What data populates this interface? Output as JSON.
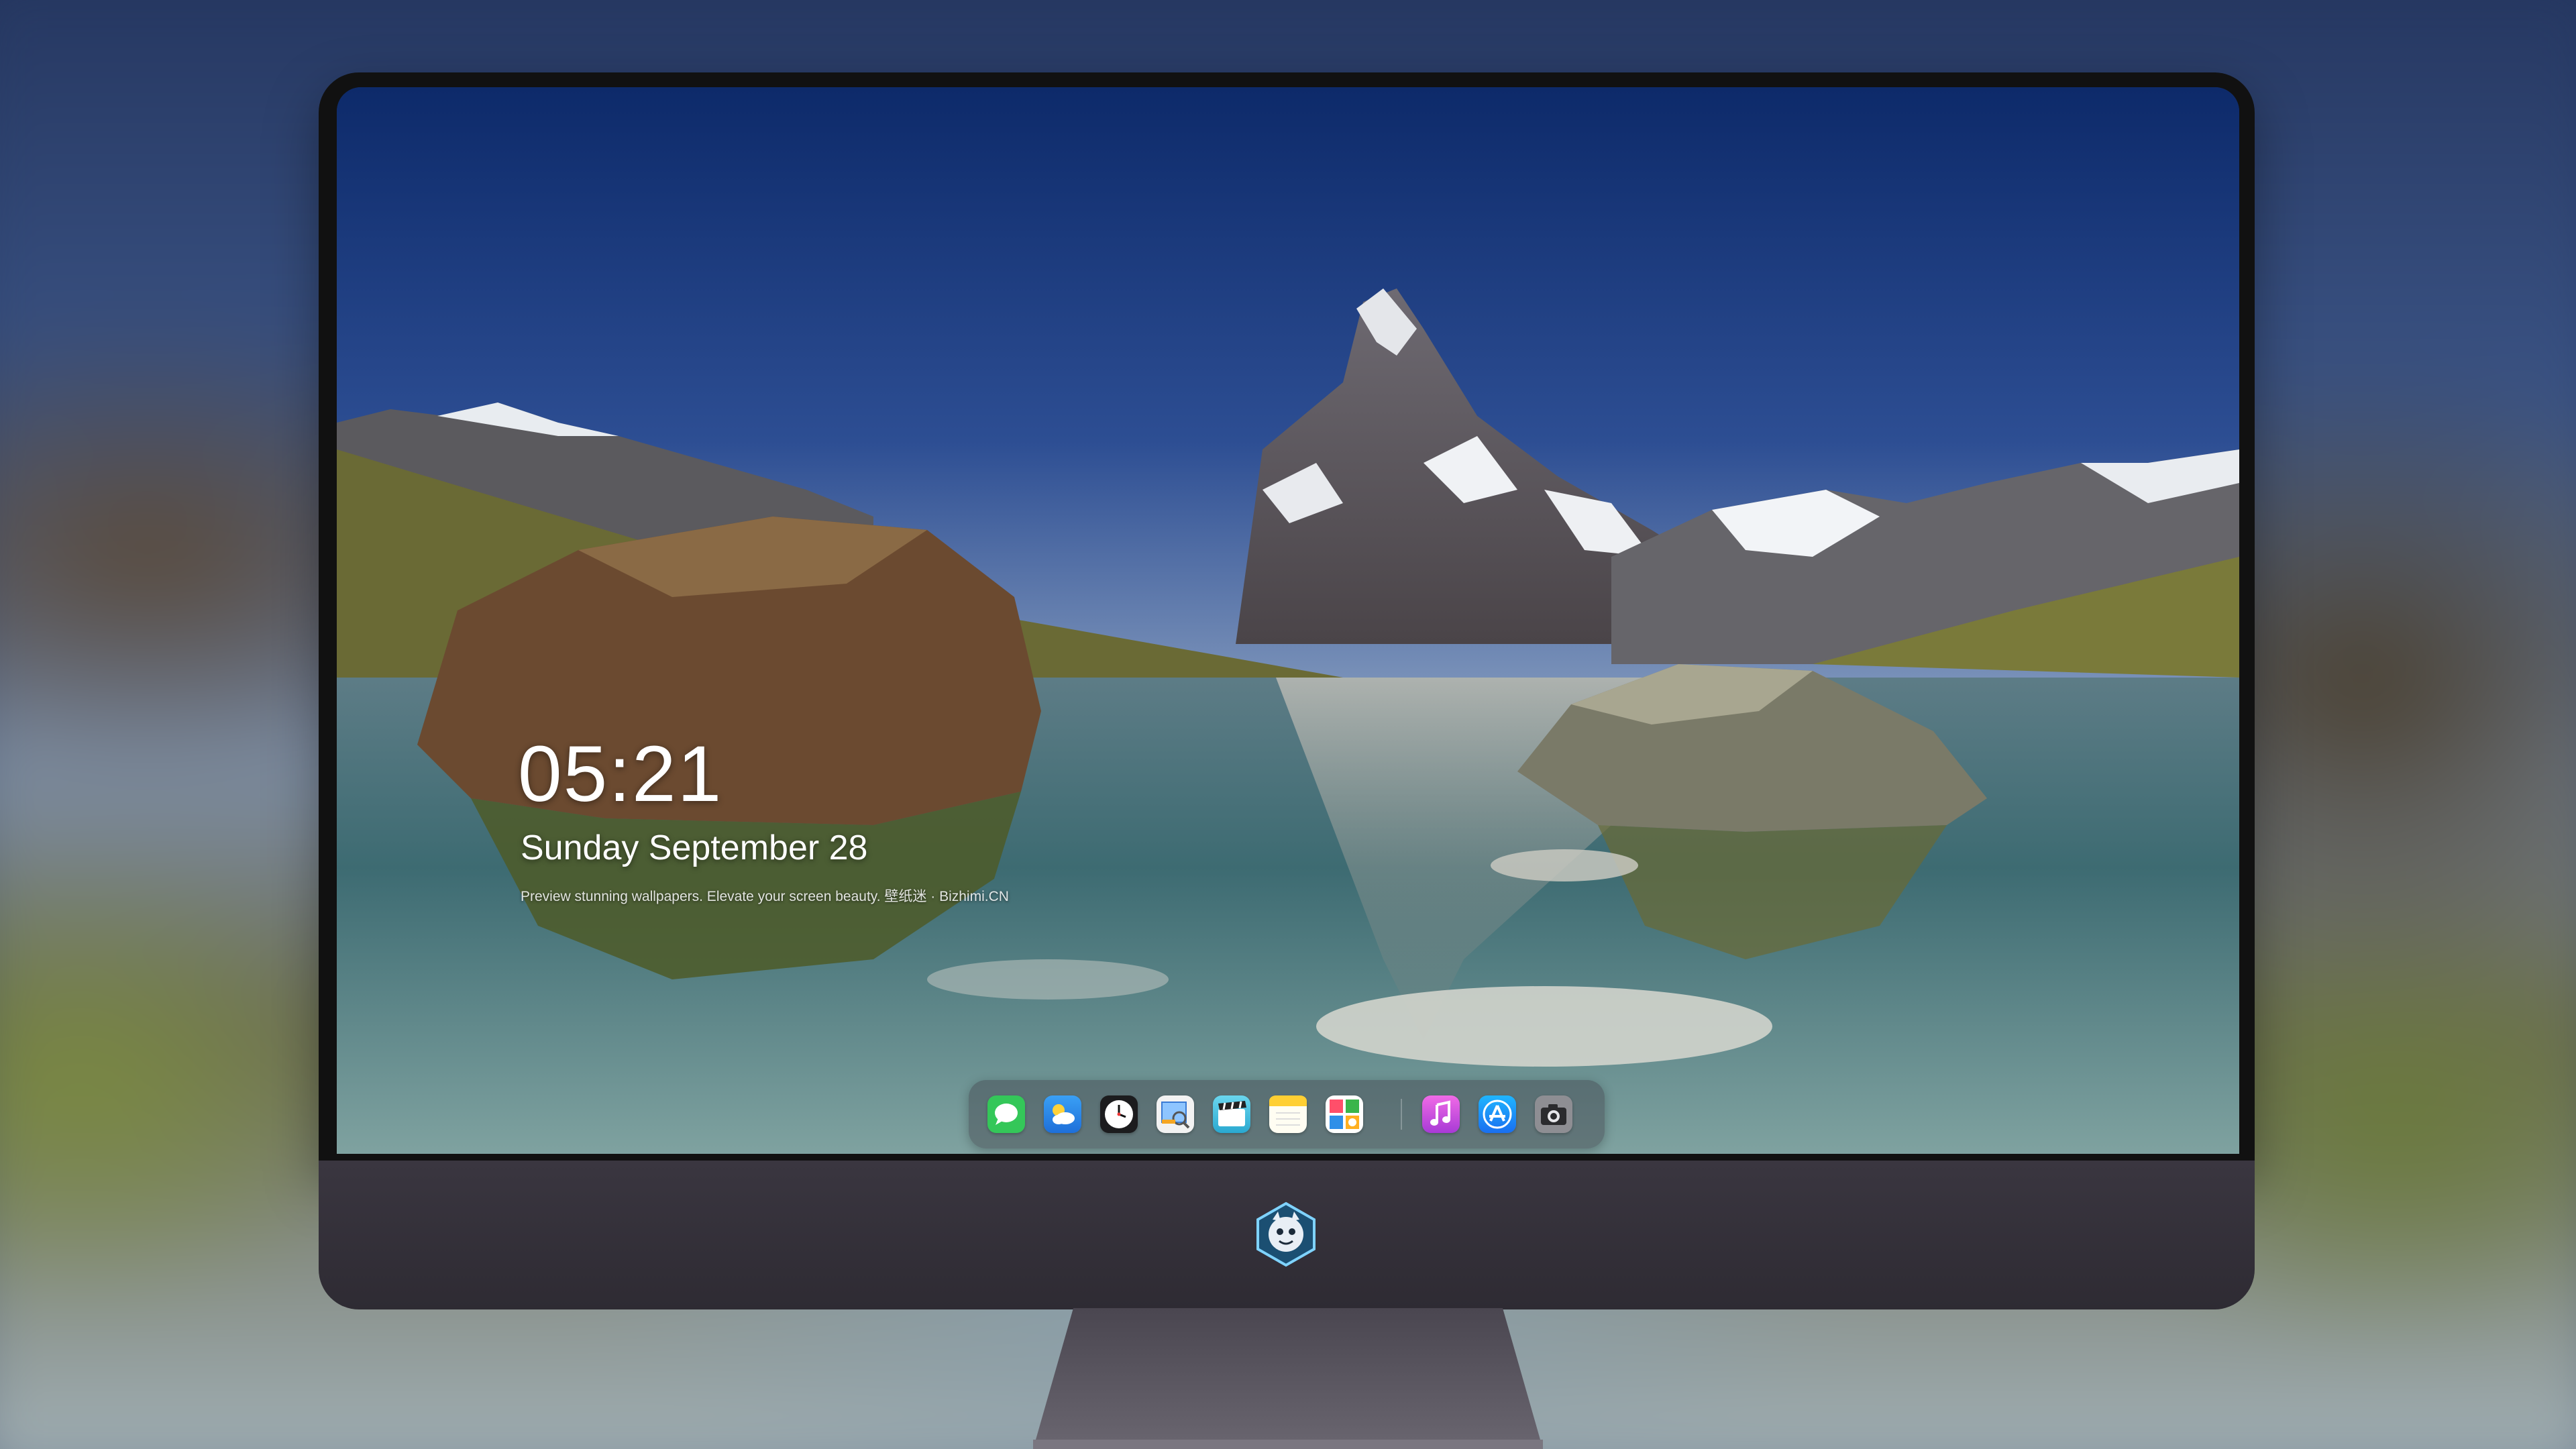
{
  "lockscreen": {
    "time": "05:21",
    "date": "Sunday September  28",
    "tagline": "Preview stunning wallpapers. Elevate your screen beauty. 壁纸迷 · Bizhimi.CN"
  },
  "dock": {
    "items": [
      {
        "icon": "messages-icon",
        "color": "#34c759"
      },
      {
        "icon": "weather-icon",
        "color": "#2f8fe8"
      },
      {
        "icon": "clock-icon",
        "color": "#1c1c1e"
      },
      {
        "icon": "preview-icon",
        "color": "#f5f5f5"
      },
      {
        "icon": "clips-icon",
        "color": "#56c6e0"
      },
      {
        "icon": "notes-icon",
        "color": "#ffd54a"
      },
      {
        "icon": "photo-booth-icon",
        "color": "#ffffff"
      },
      {
        "icon": "music-icon",
        "color": "#d14fd6"
      },
      {
        "icon": "app-store-icon",
        "color": "#1a8cff"
      },
      {
        "icon": "camera-icon",
        "color": "#8e8e93"
      }
    ]
  },
  "monitor": {
    "logo_icon": "mascot-logo-icon"
  }
}
